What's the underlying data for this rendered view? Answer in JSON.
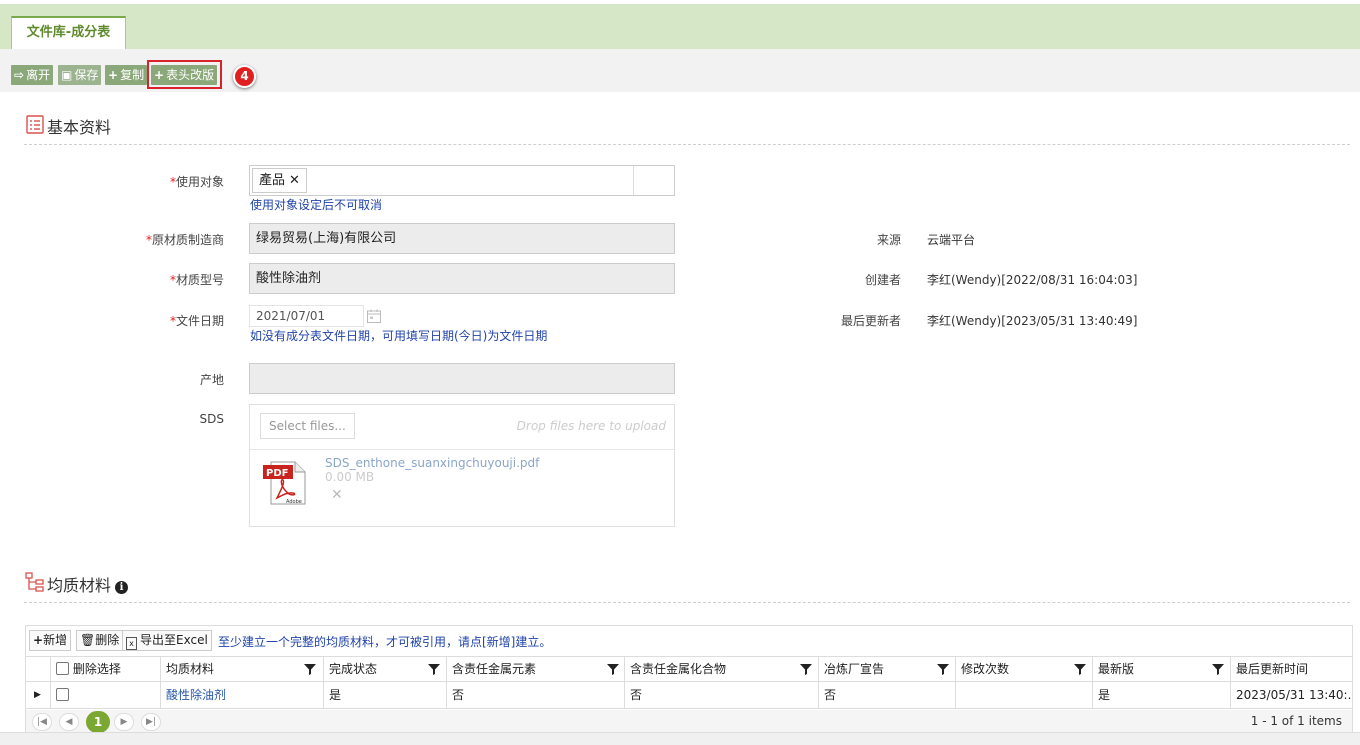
{
  "tab": {
    "label": "文件库-成分表"
  },
  "toolbar": {
    "leave": "离开",
    "save": "保存",
    "copy": "复制",
    "header_revise": "表头改版",
    "step_badge": "4"
  },
  "basic": {
    "title": "基本资料",
    "usage_target": {
      "label": "使用对象",
      "tag": "產品",
      "hint": "使用对象设定后不可取消"
    },
    "manufacturer": {
      "label": "原材质制造商",
      "value": "绿易贸易(上海)有限公司"
    },
    "material_model": {
      "label": "材质型号",
      "value": "酸性除油剂"
    },
    "doc_date": {
      "label": "文件日期",
      "value": "2021/07/01",
      "hint": "如没有成分表文件日期，可用填写日期(今日)为文件日期"
    },
    "origin": {
      "label": "产地",
      "value": ""
    },
    "sds": {
      "label": "SDS",
      "select_files": "Select files...",
      "drop_text": "Drop files here to upload",
      "file_name": "SDS_enthone_suanxingchuyouji.pdf",
      "file_size": "0.00 MB",
      "remove": "✕"
    },
    "source": {
      "label": "来源",
      "value": "云端平台"
    },
    "creator": {
      "label": "创建者",
      "value": "李红(Wendy)[2022/08/31 16:04:03]"
    },
    "last_updater": {
      "label": "最后更新者",
      "value": "李红(Wendy)[2023/05/31 13:40:49]"
    }
  },
  "homogeneous": {
    "title": "均质材料",
    "toolbar": {
      "add": "新增",
      "delete": "删除",
      "export": "导出至Excel",
      "note": "至少建立一个完整的均质材料，才可被引用，请点[新增]建立。"
    },
    "columns": [
      "删除选择",
      "均质材料",
      "完成状态",
      "含责任金属元素",
      "含责任金属化合物",
      "冶炼厂宣告",
      "修改次数",
      "最新版",
      "最后更新时间"
    ],
    "rows": [
      {
        "material": "酸性除油剂",
        "status": "是",
        "metal_element": "否",
        "metal_compound": "否",
        "smelter": "否",
        "edit_count": "",
        "latest": "是",
        "updated": "2023/05/31 13:40:..."
      }
    ],
    "pager": {
      "current": "1",
      "info": "1 - 1 of 1 items"
    }
  }
}
